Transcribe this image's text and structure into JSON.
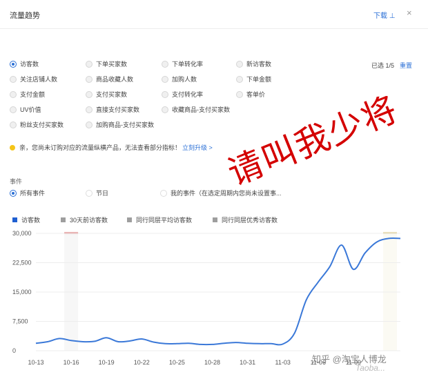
{
  "header": {
    "title": "流量趋势",
    "download": "下载 ⊥",
    "close": "×"
  },
  "metrics": {
    "rows": [
      [
        {
          "label": "访客数",
          "selected": true
        },
        {
          "label": "下单买家数"
        },
        {
          "label": "下单转化率"
        },
        {
          "label": "新访客数"
        }
      ],
      [
        {
          "label": "关注店铺人数"
        },
        {
          "label": "商品收藏人数"
        },
        {
          "label": "加购人数"
        },
        {
          "label": "下单金额"
        }
      ],
      [
        {
          "label": "支付金额"
        },
        {
          "label": "支付买家数"
        },
        {
          "label": "支付转化率"
        },
        {
          "label": "客单价"
        }
      ],
      [
        {
          "label": "UV价值"
        },
        {
          "label": "直接支付买家数"
        },
        {
          "label": "收藏商品-支付买家数"
        }
      ],
      [
        {
          "label": "粉丝支付买家数"
        },
        {
          "label": "加购商品-支付买家数"
        }
      ]
    ],
    "selected_count": "已选 1/5",
    "reset": "重置"
  },
  "notice": {
    "text": "亲，您尚未订购对应的流量纵横产品，无法查看部分指标！",
    "upgrade": "立刻升级 >"
  },
  "events": {
    "label": "事件",
    "options": [
      {
        "label": "所有事件",
        "selected": true
      },
      {
        "label": "节日"
      },
      {
        "label": "我的事件（在选定周期内您尚未设置事..."
      }
    ]
  },
  "legend": [
    {
      "label": "访客数",
      "color": "#1f5fd1"
    },
    {
      "label": "30天前访客数",
      "color": "#9e9e9e"
    },
    {
      "label": "同行同层平均访客数",
      "color": "#9e9e9e"
    },
    {
      "label": "同行同层优秀访客数",
      "color": "#9e9e9e"
    }
  ],
  "watermark": {
    "text": "请叫我少将"
  },
  "marks": {
    "zhihu": "知乎 @淘宝人博龙",
    "faint": "Taoba..."
  },
  "chart_data": {
    "type": "line",
    "ylim": [
      0,
      30000
    ],
    "yticks": [
      0,
      7500,
      15000,
      22500,
      30000
    ],
    "ytick_labels": [
      "0",
      "7,500",
      "15,000",
      "22,500",
      "30,000"
    ],
    "xtick_labels": [
      "10-13",
      "10-16",
      "10-19",
      "10-22",
      "10-25",
      "10-28",
      "10-31",
      "11-03",
      "11-06",
      "11-09"
    ],
    "x": [
      "10-13",
      "10-14",
      "10-15",
      "10-16",
      "10-17",
      "10-18",
      "10-19",
      "10-20",
      "10-21",
      "10-22",
      "10-23",
      "10-24",
      "10-25",
      "10-26",
      "10-27",
      "10-28",
      "10-29",
      "10-30",
      "10-31",
      "11-01",
      "11-02",
      "11-03",
      "11-04",
      "11-05",
      "11-06",
      "11-07",
      "11-08",
      "11-09",
      "11-10",
      "11-11",
      "11-12",
      "11-13"
    ],
    "series": [
      {
        "name": "访客数",
        "color": "#3a78d8",
        "values": [
          1900,
          2300,
          3100,
          2600,
          2300,
          2400,
          3300,
          2300,
          2500,
          3000,
          2200,
          1800,
          1800,
          1900,
          1600,
          1600,
          1900,
          2100,
          1900,
          1800,
          1800,
          1700,
          4500,
          13000,
          17500,
          21500,
          27000,
          20800,
          25000,
          27800,
          28700,
          28700
        ]
      }
    ],
    "highlight_color": "#e8a6a6",
    "highlight2_color": "#e8dcb0",
    "grid": true
  }
}
